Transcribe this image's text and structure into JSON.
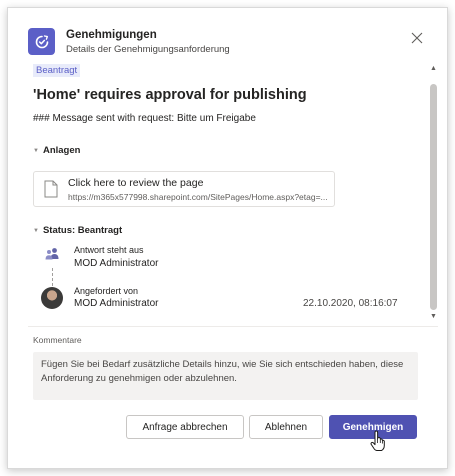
{
  "header": {
    "app_title": "Genehmigungen",
    "app_subtitle": "Details der Genehmigungsanforderung",
    "app_icon": "approvals-icon",
    "close_icon": "close-icon"
  },
  "request": {
    "status_pill": "Beantragt",
    "title": "'Home' requires approval for publishing",
    "message": "### Message sent with request: Bitte um Freigabe"
  },
  "attachments": {
    "section_label": "Anlagen",
    "file": {
      "name": "Click here to review the page",
      "url": "https://m365x577998.sharepoint.com/SitePages/Home.aspx?etag=..."
    }
  },
  "status": {
    "section_label": "Status: Beantragt",
    "timeline": [
      {
        "label": "Antwort steht aus",
        "name": "MOD Administrator",
        "icon": "people-icon",
        "date": ""
      },
      {
        "label": "Angefordert von",
        "name": "MOD Administrator",
        "icon": "avatar",
        "date": "22.10.2020, 08:16:07"
      }
    ]
  },
  "comments": {
    "label": "Kommentare",
    "placeholder": "Fügen Sie bei Bedarf zusätzliche Details hinzu, wie Sie sich entschieden haben, diese Anforderung zu genehmigen oder abzulehnen."
  },
  "actions": {
    "cancel_label": "Anfrage abbrechen",
    "reject_label": "Ablehnen",
    "approve_label": "Genehmigen"
  },
  "colors": {
    "brand": "#5b5fc7",
    "primary_button": "#4f52b2",
    "status_pill_bg": "#e8ebfa"
  }
}
